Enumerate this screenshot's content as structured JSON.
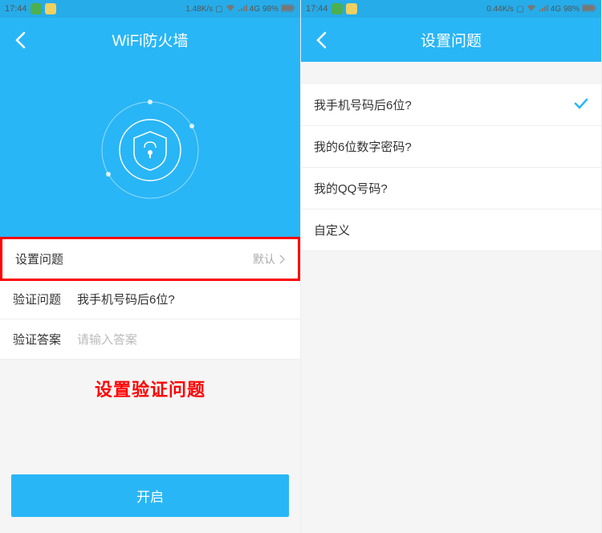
{
  "left": {
    "status": {
      "time": "17:44",
      "speed": "1.48K/s",
      "network": "4G",
      "battery": "98%"
    },
    "title": "WiFi防火墙",
    "rows": {
      "setup_question_label": "设置问题",
      "setup_question_value": "默认",
      "verify_question_label": "验证问题",
      "verify_question_value": "我手机号码后6位?",
      "verify_answer_label": "验证答案",
      "verify_answer_placeholder": "请输入答案"
    },
    "caption": "设置验证问题",
    "button": "开启"
  },
  "right": {
    "status": {
      "time": "17:44",
      "speed": "0.44K/s",
      "network": "4G",
      "battery": "98%"
    },
    "title": "设置问题",
    "options": [
      "我手机号码后6位?",
      "我的6位数字密码?",
      "我的QQ号码?",
      "自定义"
    ]
  }
}
